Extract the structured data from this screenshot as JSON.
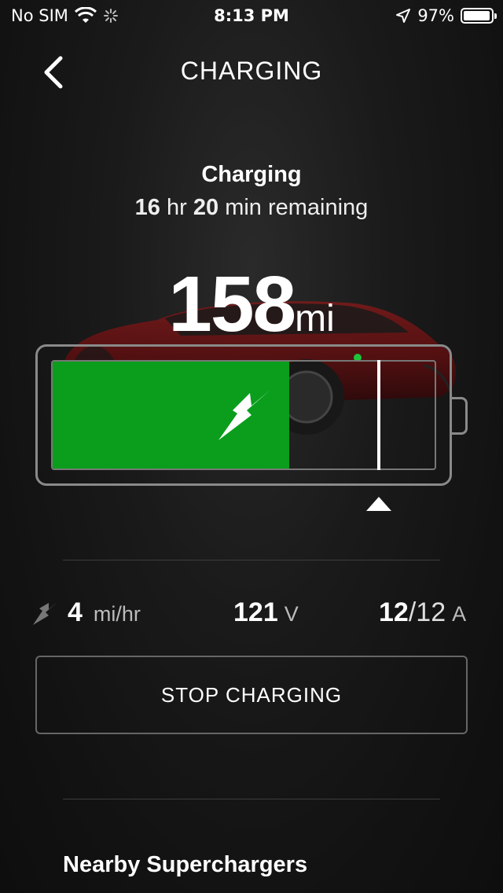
{
  "status_bar": {
    "carrier": "No SIM",
    "time": "8:13 PM",
    "battery_percent_text": "97%",
    "battery_level": 0.97,
    "icons": [
      "wifi-icon",
      "activity-spinner-icon",
      "location-arrow-icon",
      "battery-icon"
    ]
  },
  "nav": {
    "title": "CHARGING",
    "back_icon": "chevron-left-icon"
  },
  "charging_status": {
    "title": "Charging",
    "hours": "16",
    "hours_unit": "hr",
    "minutes": "20",
    "minutes_unit": "min remaining"
  },
  "range": {
    "value": "158",
    "unit": "mi"
  },
  "battery": {
    "charge_level": 0.62,
    "charge_limit": 0.85,
    "fill_color": "#0a9e1c",
    "icon": "lightning-bolt-icon"
  },
  "stats": {
    "rate_value": "4",
    "rate_unit": "mi/hr",
    "voltage_value": "121",
    "voltage_unit": "V",
    "current_actual": "12",
    "current_separator": "/",
    "current_max": "12",
    "current_unit": "A"
  },
  "actions": {
    "stop_label": "STOP CHARGING"
  },
  "superchargers": {
    "title": "Nearby Superchargers"
  }
}
